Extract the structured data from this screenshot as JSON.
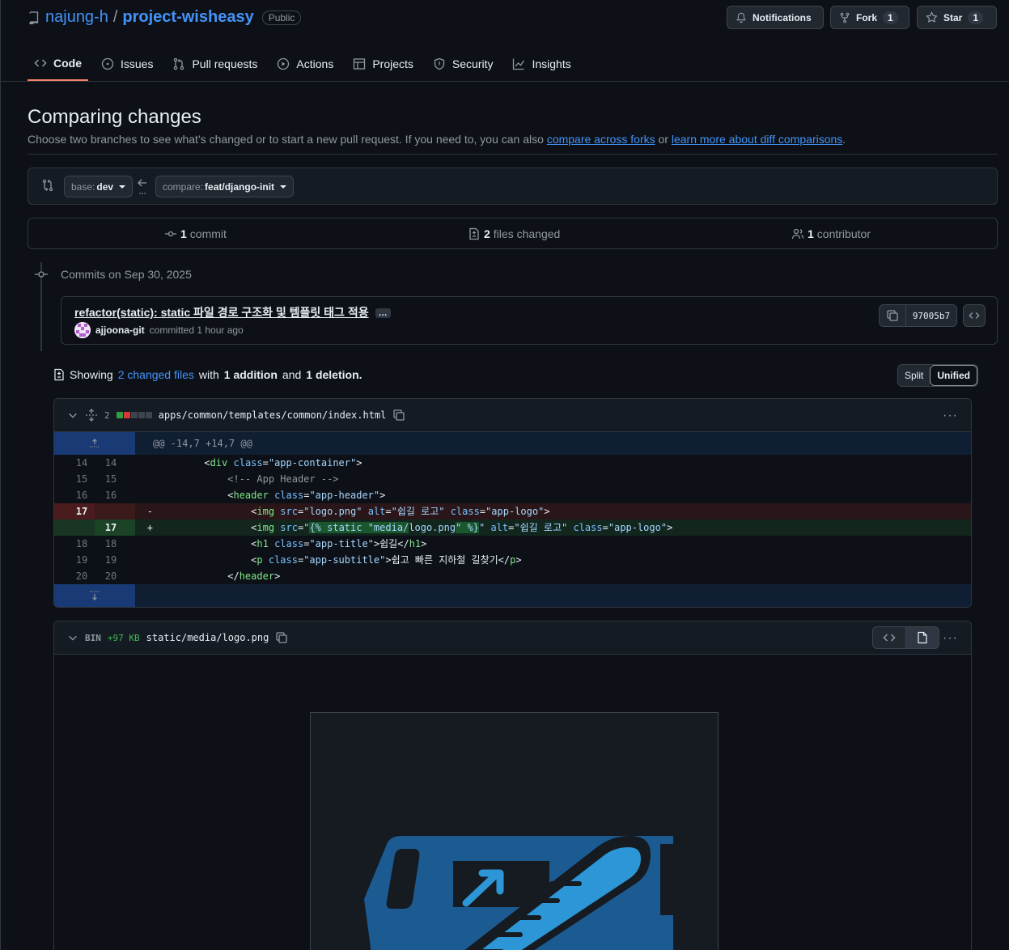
{
  "repo": {
    "owner": "najung-h",
    "separator": "/",
    "name": "project-wisheasy",
    "visibility": "Public"
  },
  "header_buttons": {
    "notifications": "Notifications",
    "fork": "Fork",
    "fork_count": "1",
    "star": "Star",
    "star_count": "1"
  },
  "tabs": [
    {
      "label": "Code",
      "icon": "code-icon",
      "active": true
    },
    {
      "label": "Issues",
      "icon": "issue-icon"
    },
    {
      "label": "Pull requests",
      "icon": "pull-request-icon"
    },
    {
      "label": "Actions",
      "icon": "play-icon"
    },
    {
      "label": "Projects",
      "icon": "table-icon"
    },
    {
      "label": "Security",
      "icon": "shield-icon"
    },
    {
      "label": "Insights",
      "icon": "graph-icon"
    }
  ],
  "compare": {
    "title": "Comparing changes",
    "subtitle_pre": "Choose two branches to see what’s changed or to start a new pull request. If you need to, you can also",
    "link1": "compare across forks",
    "mid": "or",
    "link2": "learn more about diff comparisons",
    "end": ".",
    "base_key": "base:",
    "base_val": "dev",
    "compare_key": "compare:",
    "compare_val": "feat/django-init"
  },
  "stats": {
    "commits_n": "1",
    "commits_label": "commit",
    "files_n": "2",
    "files_label": "files changed",
    "contrib_n": "1",
    "contrib_label": "contributor"
  },
  "commits": {
    "date": "Commits on Sep 30, 2025",
    "message": "refactor(static): static 파일 경로 구조화 및 템플릿 태그 적용",
    "more": "…",
    "author": "ajjoona-git",
    "action": "committed 1 hour ago",
    "sha": "97005b7"
  },
  "summary": {
    "showing": "Showing",
    "changed_files": "2 changed files",
    "with": "with",
    "additions": "1 addition",
    "and": "and",
    "deletions": "1 deletion."
  },
  "view_toggle": {
    "split": "Split",
    "unified": "Unified"
  },
  "file1": {
    "count": "2",
    "path": "apps/common/templates/common/index.html",
    "hunk": "@@ -14,7 +14,7 @@",
    "lines": [
      {
        "old": "14",
        "new": "14"
      },
      {
        "old": "15",
        "new": "15"
      },
      {
        "old": "16",
        "new": "16"
      },
      {
        "old": "17",
        "new": "",
        "sign": "-"
      },
      {
        "old": "",
        "new": "17",
        "sign": "+"
      },
      {
        "old": "18",
        "new": "18"
      },
      {
        "old": "19",
        "new": "19"
      },
      {
        "old": "20",
        "new": "20"
      }
    ],
    "code": {
      "l14_attr": "class",
      "l14_val": "\"app-container\"",
      "l15": "<!-- App Header -->",
      "l16_val": "\"app-header\"",
      "l17_src": "\"logo.png\"",
      "l17_alt": "\"쉽길 로고\"",
      "l17_cls": "\"app-logo\"",
      "l17n_src_a": "\"",
      "l17n_src_hl1": "{% static \"media/",
      "l17n_src_mid": "logo.png",
      "l17n_src_hl2": "\" %}",
      "l17n_src_b": "\"",
      "l18_cls": "\"app-title\"",
      "l18_text": "쉽길",
      "l19_cls": "\"app-subtitle\"",
      "l19_text": "쉽고 빠른 지하철 길찾기"
    }
  },
  "file2": {
    "bin": "BIN",
    "size": "+97 KB",
    "path": "static/media/logo.png"
  },
  "colors": {
    "accent": "#4493f8",
    "added": "#2ea043",
    "deleted": "#da3633",
    "tab_underline": "#f78166"
  }
}
